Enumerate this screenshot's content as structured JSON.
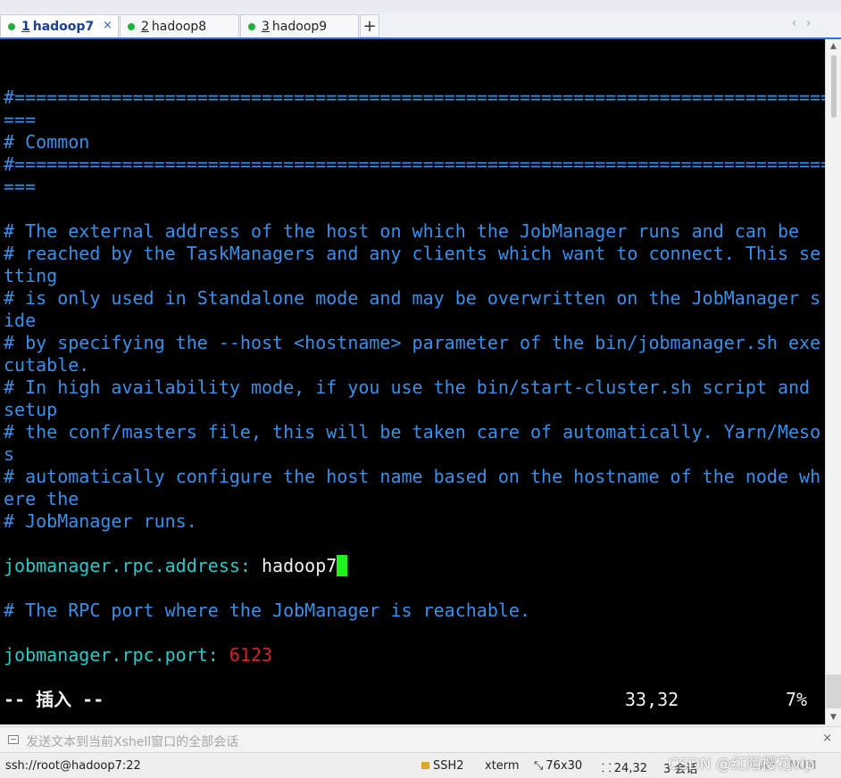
{
  "tabs": [
    {
      "num": "1",
      "label": "hadoop7",
      "active": true,
      "close": "×"
    },
    {
      "num": "2",
      "label": "hadoop8",
      "active": false
    },
    {
      "num": "3",
      "label": "hadoop9",
      "active": false
    }
  ],
  "tab_add_label": "+",
  "tab_nav": {
    "prev": "‹",
    "next": "›"
  },
  "terminal": {
    "lines": [
      {
        "text": "#============================================================================",
        "style": "comment"
      },
      {
        "text": "===",
        "style": "comment"
      },
      {
        "text": "# Common",
        "style": "comment"
      },
      {
        "text": "#============================================================================",
        "style": "comment"
      },
      {
        "text": "===",
        "style": "comment"
      },
      {
        "text": "",
        "style": "comment"
      },
      {
        "text": "# The external address of the host on which the JobManager runs and can be",
        "style": "comment"
      },
      {
        "text": "# reached by the TaskManagers and any clients which want to connect. This se",
        "style": "comment"
      },
      {
        "text": "tting",
        "style": "comment"
      },
      {
        "text": "# is only used in Standalone mode and may be overwritten on the JobManager s",
        "style": "comment"
      },
      {
        "text": "ide",
        "style": "comment"
      },
      {
        "text": "# by specifying the --host <hostname> parameter of the bin/jobmanager.sh exe",
        "style": "comment"
      },
      {
        "text": "cutable.",
        "style": "comment"
      },
      {
        "text": "# In high availability mode, if you use the bin/start-cluster.sh script and",
        "style": "comment"
      },
      {
        "text": "setup",
        "style": "comment"
      },
      {
        "text": "# the conf/masters file, this will be taken care of automatically. Yarn/Meso",
        "style": "comment"
      },
      {
        "text": "s",
        "style": "comment"
      },
      {
        "text": "# automatically configure the host name based on the hostname of the node wh",
        "style": "comment"
      },
      {
        "text": "ere the",
        "style": "comment"
      },
      {
        "text": "# JobManager runs.",
        "style": "comment"
      }
    ],
    "rpc_address": {
      "key": "jobmanager.rpc.address",
      "sep": ": ",
      "value": "hadoop7"
    },
    "rpc_comment": "# The RPC port where the JobManager is reachable.",
    "rpc_port": {
      "key": "jobmanager.rpc.port",
      "sep": ": ",
      "value": "6123"
    },
    "mode_line": "-- 插入 --",
    "position": "33,32",
    "percent": "7%"
  },
  "send_bar": {
    "placeholder": "发送文本到当前Xshell窗口的全部会话",
    "close": "×"
  },
  "status": {
    "connection": "ssh://root@hadoop7:22",
    "protocol": "SSH2",
    "term": "xterm",
    "size": "76x30",
    "cursor": "24,32",
    "sessions": "3 会话",
    "caps": "CAP",
    "num": "NUM"
  },
  "watermark": "CSDN @红陌樱花vip",
  "colors": {
    "comment": "#3c8fe8",
    "key": "#2fc8c8",
    "number": "#d42424",
    "cursor": "#22f022",
    "tab_accent": "#2f6fd6"
  }
}
